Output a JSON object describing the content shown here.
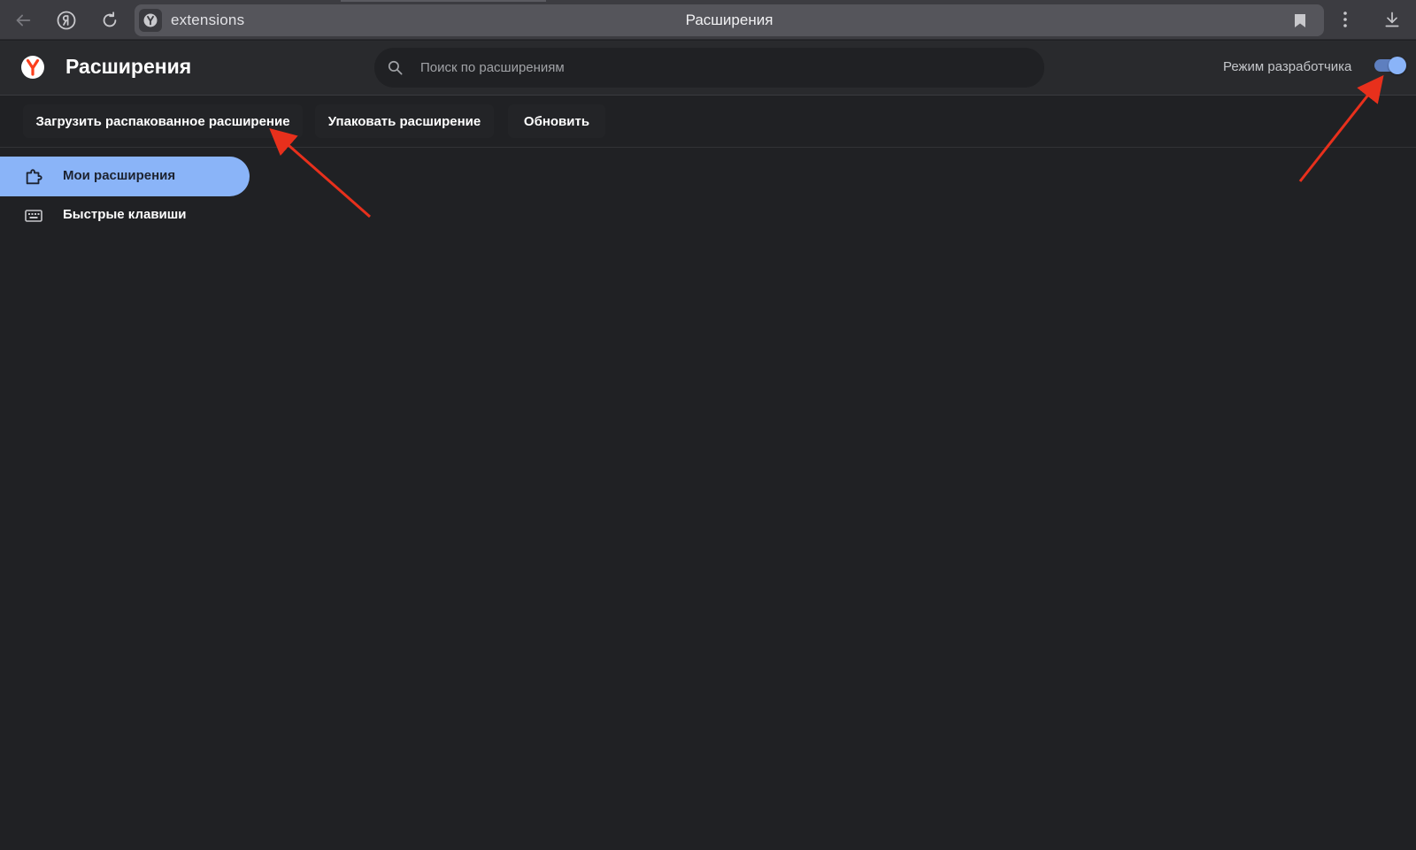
{
  "browser": {
    "address_url": "extensions",
    "address_title": "Расширения",
    "icons": {
      "back": "arrow-left-icon",
      "yandex": "yandex-ya-icon",
      "reload": "reload-icon",
      "bookmark": "bookmark-icon",
      "menu": "kebab-menu-icon",
      "download": "download-icon"
    }
  },
  "header": {
    "title": "Расширения",
    "search_placeholder": "Поиск по расширениям",
    "dev_mode_label": "Режим разработчика",
    "dev_mode_enabled": true
  },
  "toolbar": {
    "load_unpacked": "Загрузить распакованное расширение",
    "pack": "Упаковать расширение",
    "update": "Обновить"
  },
  "sidebar": {
    "items": [
      {
        "label": "Мои расширения",
        "icon": "puzzle-icon",
        "active": true
      },
      {
        "label": "Быстрые клавиши",
        "icon": "keyboard-icon",
        "active": false
      }
    ]
  },
  "colors": {
    "background": "#202124",
    "header_bg": "#292a2d",
    "accent": "#8ab4f8",
    "annotation_arrow": "#e8301c",
    "yandex_red": "#fc3f1d"
  }
}
